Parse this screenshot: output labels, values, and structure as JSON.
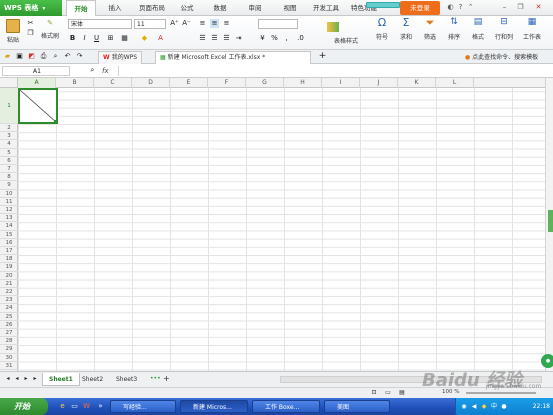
{
  "app": {
    "brand": "WPS 表格",
    "accent": "#2e9a2e"
  },
  "menu": {
    "tabs": [
      "开始",
      "插入",
      "页面布局",
      "公式",
      "数据",
      "审阅",
      "视图",
      "开发工具",
      "特色功能"
    ],
    "active": "开始",
    "not_logged_in": "未登录"
  },
  "ribbon": {
    "paste": "粘贴",
    "format_painter": "格式刷",
    "font_name": "宋体",
    "font_size": "11",
    "table_style": "表格样式",
    "symbol": "符号",
    "sum": "求和",
    "filter": "筛选",
    "sort": "排序",
    "format": "格式",
    "rows_cols": "行和列",
    "worksheet": "工作表"
  },
  "filetabs": {
    "shell": "我的WPS",
    "current": "新建 Microsoft Excel 工作表.xlsx *",
    "hint": "点此查找命令、搜索模板"
  },
  "formula": {
    "cell_ref": "A1",
    "fx": "fx"
  },
  "grid": {
    "columns": [
      "A",
      "B",
      "C",
      "D",
      "E",
      "F",
      "G",
      "H",
      "I",
      "J",
      "K",
      "L"
    ],
    "rows": [
      "1",
      "2",
      "3",
      "4",
      "5",
      "6",
      "7",
      "8",
      "9",
      "10",
      "11",
      "12",
      "13",
      "14",
      "15",
      "16",
      "17",
      "18",
      "19",
      "20",
      "21",
      "22",
      "23",
      "24",
      "25",
      "26",
      "27",
      "28",
      "29",
      "30",
      "31"
    ]
  },
  "sheets": {
    "tabs": [
      "Sheet1",
      "Sheet2",
      "Sheet3"
    ],
    "active": "Sheet1",
    "more": "•••",
    "add": "+"
  },
  "status": {
    "zoom": "100 %"
  },
  "taskbar": {
    "start": "开始",
    "items": [
      "写经验...",
      "新建 Micros...",
      "工作 Boxe...",
      "美图"
    ],
    "clock": "22:18"
  },
  "watermark": {
    "brand": "Baidu 经验",
    "sub": "jingyan.baidu.com"
  }
}
